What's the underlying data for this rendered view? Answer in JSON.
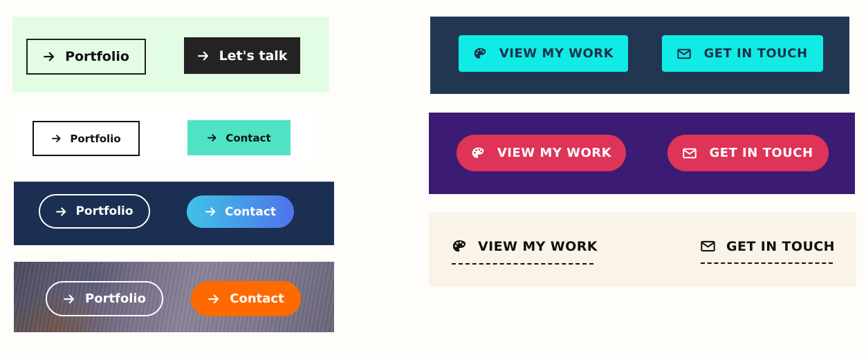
{
  "colors": {
    "mint": "#e3fde5",
    "dark": "#232323",
    "teal": "#4fe3c4",
    "navy": "#1b2f52",
    "orange": "#ff6a00",
    "slate": "#213650",
    "cyan": "#11ebe6",
    "purple": "#3b1b73",
    "crimson": "#de3457",
    "cream": "#faf3e8"
  },
  "icons": {
    "arrow": "arrow-right-icon",
    "palette": "palette-icon",
    "envelope": "envelope-icon"
  },
  "row1": {
    "left_label": "Portfolio",
    "right_label": "Let's talk"
  },
  "row2": {
    "left_label": "Portfolio",
    "right_label": "Contact"
  },
  "row3": {
    "left_label": "Portfolio",
    "right_label": "Contact"
  },
  "row4": {
    "left_label": "Portfolio",
    "right_label": "Contact"
  },
  "row5": {
    "left_label": "VIEW MY WORK",
    "right_label": "GET IN TOUCH"
  },
  "row6": {
    "left_label": "VIEW MY WORK",
    "right_label": "GET IN TOUCH"
  },
  "row7": {
    "left_label": "VIEW MY WORK",
    "right_label": "GET IN TOUCH"
  }
}
